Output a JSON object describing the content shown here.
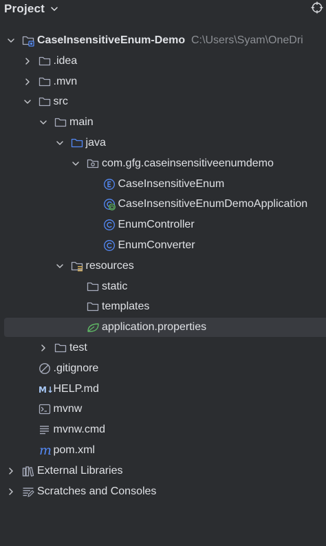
{
  "header": {
    "title": "Project"
  },
  "tree": [
    {
      "id": "root",
      "label": "CaseInsensitiveEnum-Demo",
      "path": "C:\\Users\\Syam\\OneDri",
      "depth": 0,
      "expandable": true,
      "expanded": true,
      "icon": "module-folder-icon",
      "bold": true
    },
    {
      "id": "idea",
      "label": ".idea",
      "depth": 1,
      "expandable": true,
      "expanded": false,
      "icon": "folder-icon"
    },
    {
      "id": "mvn",
      "label": ".mvn",
      "depth": 1,
      "expandable": true,
      "expanded": false,
      "icon": "folder-icon"
    },
    {
      "id": "src",
      "label": "src",
      "depth": 1,
      "expandable": true,
      "expanded": true,
      "icon": "folder-icon"
    },
    {
      "id": "main",
      "label": "main",
      "depth": 2,
      "expandable": true,
      "expanded": true,
      "icon": "folder-icon"
    },
    {
      "id": "java",
      "label": "java",
      "depth": 3,
      "expandable": true,
      "expanded": true,
      "icon": "source-folder-icon"
    },
    {
      "id": "pkg",
      "label": "com.gfg.caseinsensitiveenumdemo",
      "depth": 4,
      "expandable": true,
      "expanded": true,
      "icon": "package-icon"
    },
    {
      "id": "enum",
      "label": "CaseInsensitiveEnum",
      "depth": 5,
      "expandable": false,
      "icon": "enum-icon"
    },
    {
      "id": "app",
      "label": "CaseInsensitiveEnumDemoApplication",
      "depth": 5,
      "expandable": false,
      "icon": "spring-boot-class-icon"
    },
    {
      "id": "controller",
      "label": "EnumController",
      "depth": 5,
      "expandable": false,
      "icon": "class-icon"
    },
    {
      "id": "converter",
      "label": "EnumConverter",
      "depth": 5,
      "expandable": false,
      "icon": "class-icon"
    },
    {
      "id": "resources",
      "label": "resources",
      "depth": 3,
      "expandable": true,
      "expanded": true,
      "icon": "resources-folder-icon"
    },
    {
      "id": "static",
      "label": "static",
      "depth": 4,
      "expandable": false,
      "icon": "folder-icon"
    },
    {
      "id": "templates",
      "label": "templates",
      "depth": 4,
      "expandable": false,
      "icon": "folder-icon"
    },
    {
      "id": "appprops",
      "label": "application.properties",
      "depth": 4,
      "expandable": false,
      "icon": "spring-properties-icon",
      "selected": true
    },
    {
      "id": "test",
      "label": "test",
      "depth": 2,
      "expandable": true,
      "expanded": false,
      "icon": "folder-icon"
    },
    {
      "id": "gitignore",
      "label": ".gitignore",
      "depth": 1,
      "expandable": false,
      "icon": "gitignore-icon"
    },
    {
      "id": "help",
      "label": "HELP.md",
      "depth": 1,
      "expandable": false,
      "icon": "markdown-icon",
      "icon_text": "M↓"
    },
    {
      "id": "mvnw",
      "label": "mvnw",
      "depth": 1,
      "expandable": false,
      "icon": "shell-script-icon"
    },
    {
      "id": "mvnwcmd",
      "label": "mvnw.cmd",
      "depth": 1,
      "expandable": false,
      "icon": "text-file-icon"
    },
    {
      "id": "pom",
      "label": "pom.xml",
      "depth": 1,
      "expandable": false,
      "icon": "maven-icon",
      "icon_text": "m"
    },
    {
      "id": "extlib",
      "label": "External Libraries",
      "depth": 0,
      "expandable": true,
      "expanded": false,
      "icon": "library-icon"
    },
    {
      "id": "scratches",
      "label": "Scratches and Consoles",
      "depth": 0,
      "expandable": true,
      "expanded": false,
      "icon": "scratches-icon"
    }
  ],
  "colors": {
    "background": "#2b2d30",
    "selection": "#393b40",
    "text": "#dfe1e5",
    "muted": "#8c8f94",
    "icon_gray": "#a8adbd",
    "source_blue": "#548af7",
    "spring_green": "#5fb865",
    "resources_yellow": "#d6ae58"
  }
}
